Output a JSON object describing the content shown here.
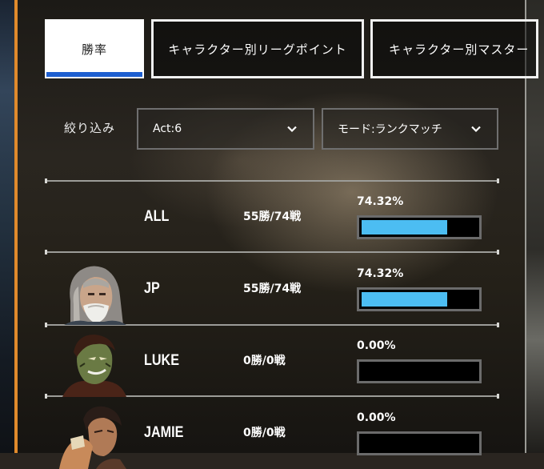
{
  "tabs": [
    {
      "label": "勝率",
      "active": true
    },
    {
      "label": "キャラクター別リーグポイント",
      "active": false
    },
    {
      "label": "キャラクター別マスター",
      "active": false
    }
  ],
  "filter": {
    "label": "絞り込み",
    "act": "Act:6",
    "mode": "モード:ランクマッチ"
  },
  "rows": [
    {
      "name": "ALL",
      "record": "55勝/74戦",
      "percent": "74.32%",
      "rate": 0.7432,
      "avatar": "none"
    },
    {
      "name": "JP",
      "record": "55勝/74戦",
      "percent": "74.32%",
      "rate": 0.7432,
      "avatar": "jp-portrait"
    },
    {
      "name": "LUKE",
      "record": "0勝/0戦",
      "percent": "0.00%",
      "rate": 0.0,
      "avatar": "luke-portrait"
    },
    {
      "name": "JAMIE",
      "record": "0勝/0戦",
      "percent": "0.00%",
      "rate": 0.0,
      "avatar": "jamie-portrait"
    }
  ],
  "colors": {
    "accent": "#1e5fd0",
    "bar_fill": "#4cbdf2",
    "left_border": "#e08a2c"
  }
}
